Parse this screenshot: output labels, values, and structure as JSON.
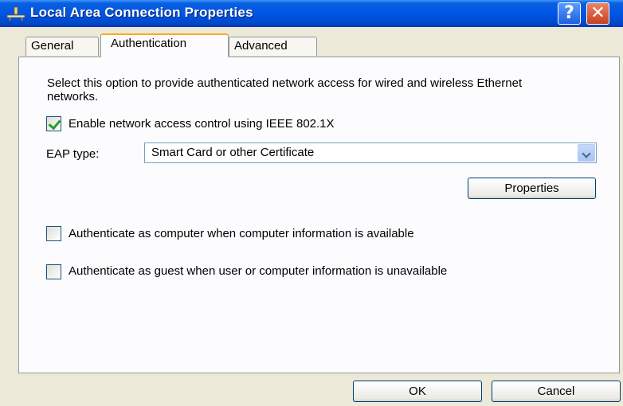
{
  "window": {
    "title": "Local Area Connection Properties",
    "help_label": "?",
    "close_label": "✕"
  },
  "tabs": [
    {
      "label": "General",
      "selected": false
    },
    {
      "label": "Authentication",
      "selected": true
    },
    {
      "label": "Advanced",
      "selected": false
    }
  ],
  "authentication": {
    "description": "Select this option to provide authenticated network access for wired and wireless Ethernet networks.",
    "enable_8021x": {
      "label": "Enable network access control using IEEE 802.1X",
      "checked": true
    },
    "eap_type": {
      "label": "EAP type:",
      "selected": "Smart Card or other Certificate"
    },
    "properties_button": "Properties",
    "auth_as_computer": {
      "label": "Authenticate as computer when computer information is available",
      "checked": false
    },
    "auth_as_guest": {
      "label": "Authenticate as guest when user or computer information is unavailable",
      "checked": false
    }
  },
  "footer": {
    "ok_label": "OK",
    "cancel_label": "Cancel"
  },
  "colors": {
    "titlebar": "#0055e5",
    "dialog_bg": "#ece9d8",
    "checkmark": "#21a121",
    "selected_tab_accent": "#f7a928"
  },
  "icons": {
    "title_icon": "network-connection-icon",
    "dropdown_icon": "chevron-down-icon",
    "check_icon": "checkmark-icon"
  }
}
